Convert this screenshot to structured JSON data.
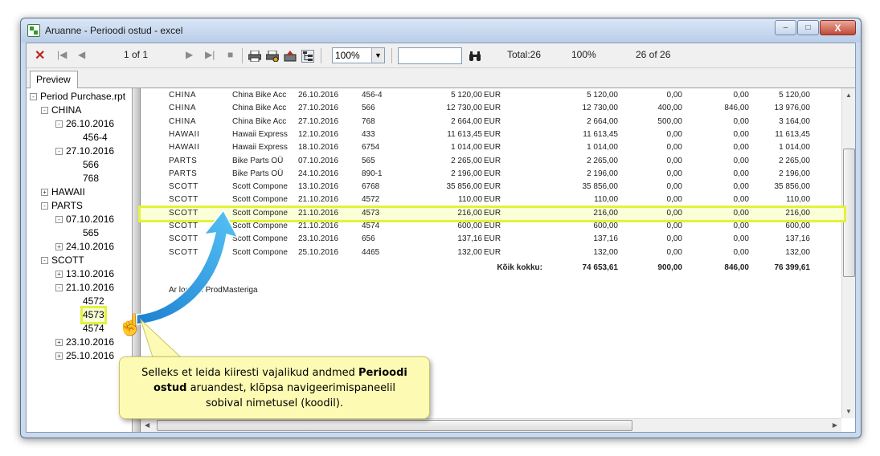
{
  "window": {
    "title": "Aruanne - Perioodi ostud - excel",
    "buttons": {
      "minimize": "–",
      "maximize": "□",
      "close": "X"
    }
  },
  "toolbar": {
    "close_icon": "✕",
    "first_icon": "|◀",
    "prev_icon": "◀",
    "page": "1 of 1",
    "next_icon": "▶",
    "last_icon": "▶|",
    "stop_icon": "■",
    "print_icon": "printer-icon",
    "print_setup_icon": "printer-setup-icon",
    "export_icon": "export-icon",
    "tree_toggle_icon": "group-tree-icon",
    "zoom": "100%",
    "search_placeholder": "",
    "search_icon": "binoculars-icon",
    "total": "Total:26",
    "percent": "100%",
    "records": "26 of 26"
  },
  "tabs": [
    {
      "label": "Preview"
    }
  ],
  "tree": [
    {
      "label": "Period Purchase.rpt",
      "exp": "-"
    },
    {
      "label": "CHINA",
      "exp": "-"
    },
    {
      "label": "26.10.2016",
      "exp": "-"
    },
    {
      "label": "456-4",
      "exp": ""
    },
    {
      "label": "27.10.2016",
      "exp": "-"
    },
    {
      "label": "566",
      "exp": ""
    },
    {
      "label": "768",
      "exp": ""
    },
    {
      "label": "HAWAII",
      "exp": "+"
    },
    {
      "label": "PARTS",
      "exp": "-"
    },
    {
      "label": "07.10.2016",
      "exp": "-"
    },
    {
      "label": "565",
      "exp": ""
    },
    {
      "label": "24.10.2016",
      "exp": "+"
    },
    {
      "label": "SCOTT",
      "exp": "-"
    },
    {
      "label": "13.10.2016",
      "exp": "+"
    },
    {
      "label": "21.10.2016",
      "exp": "-"
    },
    {
      "label": "4572",
      "exp": ""
    },
    {
      "label": "4573",
      "exp": ""
    },
    {
      "label": "4574",
      "exp": ""
    },
    {
      "label": "23.10.2016",
      "exp": "+"
    },
    {
      "label": "25.10.2016",
      "exp": "+"
    }
  ],
  "report": {
    "rows": [
      {
        "group": "CHINA",
        "supplier": "China Bike Acc",
        "date": "26.10.2016",
        "doc": "456-4",
        "amount": "5 120,00",
        "currency": "EUR",
        "net": "5 120,00",
        "v1": "0,00",
        "v2": "0,00",
        "total": "5 120,00"
      },
      {
        "group": "CHINA",
        "supplier": "China Bike Acc",
        "date": "27.10.2016",
        "doc": "566",
        "amount": "12 730,00",
        "currency": "EUR",
        "net": "12 730,00",
        "v1": "400,00",
        "v2": "846,00",
        "total": "13 976,00"
      },
      {
        "group": "CHINA",
        "supplier": "China Bike Acc",
        "date": "27.10.2016",
        "doc": "768",
        "amount": "2 664,00",
        "currency": "EUR",
        "net": "2 664,00",
        "v1": "500,00",
        "v2": "0,00",
        "total": "3 164,00"
      },
      {
        "group": "HAWAII",
        "supplier": "Hawaii Express",
        "date": "12.10.2016",
        "doc": "433",
        "amount": "11 613,45",
        "currency": "EUR",
        "net": "11 613,45",
        "v1": "0,00",
        "v2": "0,00",
        "total": "11 613,45"
      },
      {
        "group": "HAWAII",
        "supplier": "Hawaii Express",
        "date": "18.10.2016",
        "doc": "6754",
        "amount": "1 014,00",
        "currency": "EUR",
        "net": "1 014,00",
        "v1": "0,00",
        "v2": "0,00",
        "total": "1 014,00"
      },
      {
        "group": "PARTS",
        "supplier": "Bike Parts OÜ",
        "date": "07.10.2016",
        "doc": "565",
        "amount": "2 265,00",
        "currency": "EUR",
        "net": "2 265,00",
        "v1": "0,00",
        "v2": "0,00",
        "total": "2 265,00"
      },
      {
        "group": "PARTS",
        "supplier": "Bike Parts OÜ",
        "date": "24.10.2016",
        "doc": "890-1",
        "amount": "2 196,00",
        "currency": "EUR",
        "net": "2 196,00",
        "v1": "0,00",
        "v2": "0,00",
        "total": "2 196,00"
      },
      {
        "group": "SCOTT",
        "supplier": "Scott Compone",
        "date": "13.10.2016",
        "doc": "6768",
        "amount": "35 856,00",
        "currency": "EUR",
        "net": "35 856,00",
        "v1": "0,00",
        "v2": "0,00",
        "total": "35 856,00"
      },
      {
        "group": "SCOTT",
        "supplier": "Scott Compone",
        "date": "21.10.2016",
        "doc": "4572",
        "amount": "110,00",
        "currency": "EUR",
        "net": "110,00",
        "v1": "0,00",
        "v2": "0,00",
        "total": "110,00"
      },
      {
        "group": "SCOTT",
        "supplier": "Scott Compone",
        "date": "21.10.2016",
        "doc": "4573",
        "amount": "216,00",
        "currency": "EUR",
        "net": "216,00",
        "v1": "0,00",
        "v2": "0,00",
        "total": "216,00"
      },
      {
        "group": "SCOTT",
        "supplier": "Scott Compone",
        "date": "21.10.2016",
        "doc": "4574",
        "amount": "600,00",
        "currency": "EUR",
        "net": "600,00",
        "v1": "0,00",
        "v2": "0,00",
        "total": "600,00"
      },
      {
        "group": "SCOTT",
        "supplier": "Scott Compone",
        "date": "23.10.2016",
        "doc": "656",
        "amount": "137,16",
        "currency": "EUR",
        "net": "137,16",
        "v1": "0,00",
        "v2": "0,00",
        "total": "137,16"
      },
      {
        "group": "SCOTT",
        "supplier": "Scott Compone",
        "date": "25.10.2016",
        "doc": "4465",
        "amount": "132,00",
        "currency": "EUR",
        "net": "132,00",
        "v1": "0,00",
        "v2": "0,00",
        "total": "132,00"
      }
    ],
    "total_label": "Kõik kokku:",
    "totals": {
      "net": "74 653,61",
      "v1": "900,00",
      "v2": "846,00",
      "total": "76 399,61"
    },
    "footer": "Ar        loodud ProdMasteriga"
  },
  "callout": {
    "text_before": "Selleks et leida kiiresti vajalikud andmed ",
    "bold": "Perioodi ostud",
    "text_after": " aruandest, klõpsa navigeerimispaneelil sobival nimetusel (koodil)."
  },
  "colors": {
    "highlight": "#e3f23a",
    "callout_bg": "#fdfbb3",
    "arrow": "#2a9be0"
  }
}
